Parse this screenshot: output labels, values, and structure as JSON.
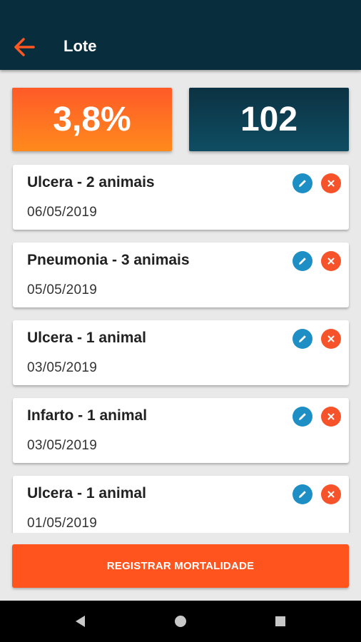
{
  "header": {
    "title": "Lote",
    "back_icon": "arrow-left-icon",
    "back_color": "#ff5722",
    "background": "#082d3d"
  },
  "stats": {
    "mortality_rate": "3,8%",
    "count": "102"
  },
  "records": [
    {
      "title": "Ulcera - 2 animais",
      "date": "06/05/2019"
    },
    {
      "title": "Pneumonia - 3 animais",
      "date": "05/05/2019"
    },
    {
      "title": "Ulcera - 1 animal",
      "date": "03/05/2019"
    },
    {
      "title": "Infarto - 1 animal",
      "date": "03/05/2019"
    },
    {
      "title": "Ulcera - 1 animal",
      "date": "01/05/2019"
    }
  ],
  "record_actions": {
    "edit_icon": "pencil-icon",
    "delete_icon": "close-icon",
    "edit_color": "#1e8fc4",
    "delete_color": "#f7532a"
  },
  "footer": {
    "register_label": "REGISTRAR MORTALIDADE"
  },
  "system_nav": {
    "back_icon": "triangle-back-icon",
    "home_icon": "circle-home-icon",
    "recents_icon": "square-recents-icon"
  }
}
